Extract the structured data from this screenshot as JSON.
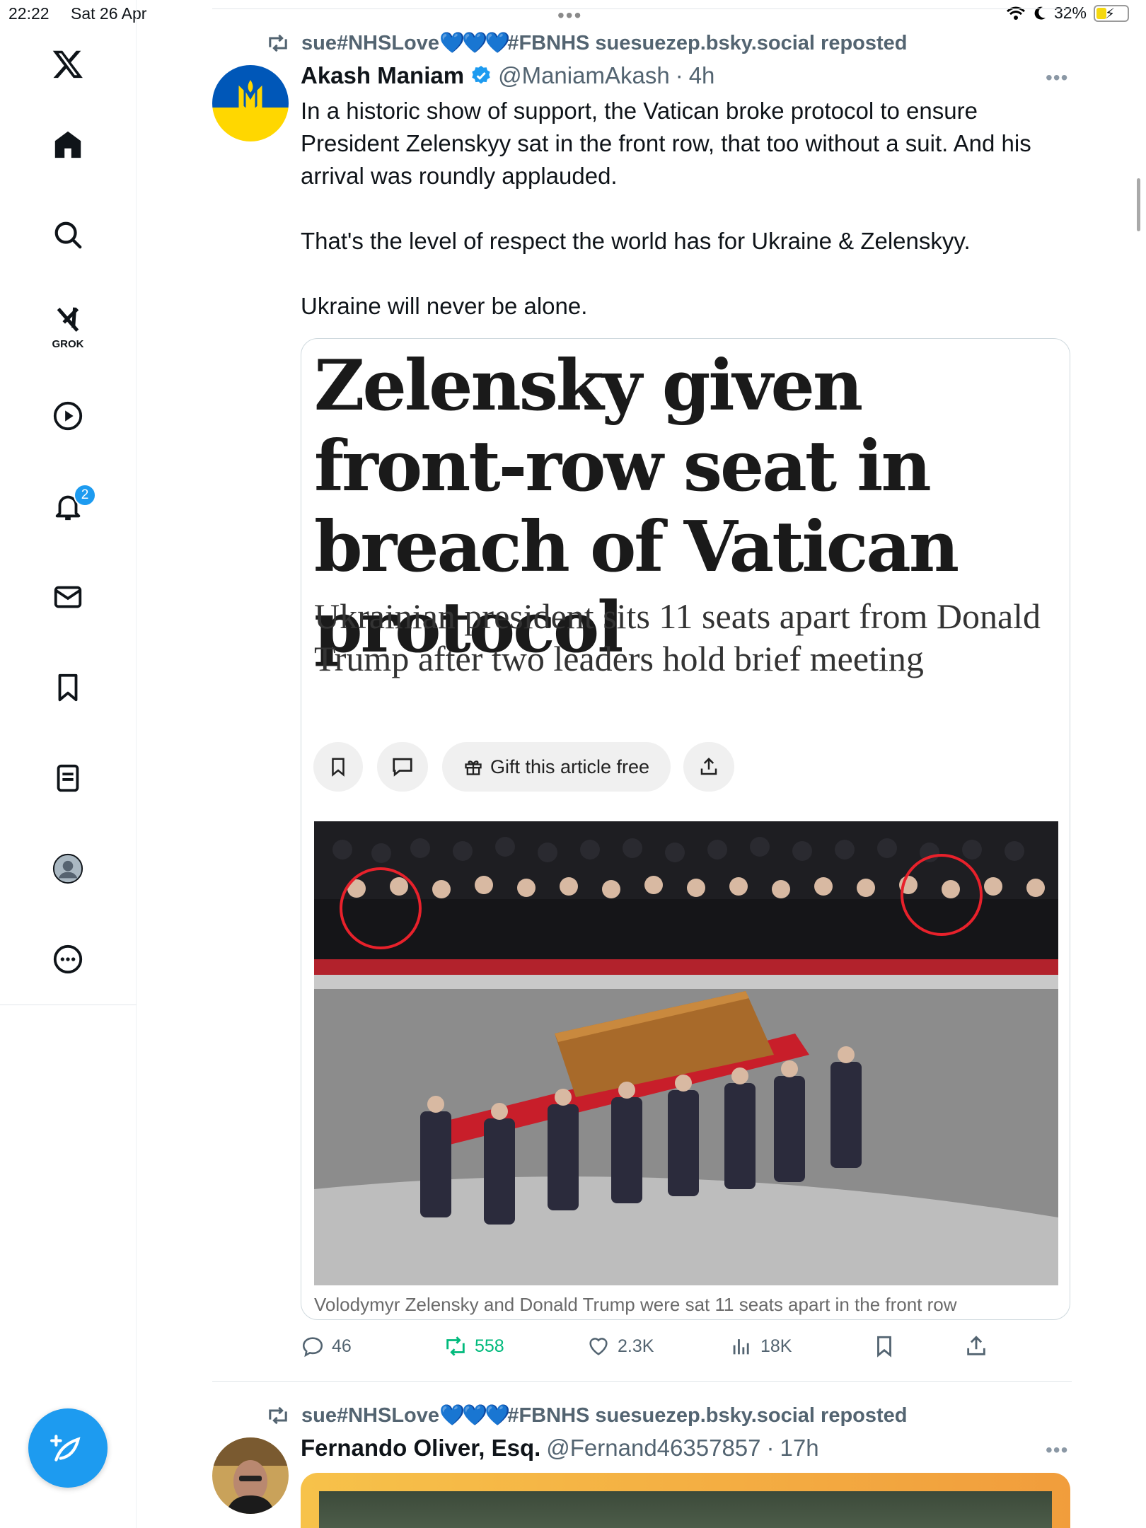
{
  "status_bar": {
    "time": "22:22",
    "date": "Sat 26 Apr",
    "battery": "32%"
  },
  "sidebar": {
    "items": [
      {
        "name": "x-logo-icon"
      },
      {
        "name": "home-icon"
      },
      {
        "name": "search-icon"
      },
      {
        "name": "grok-icon",
        "label": "GROK"
      },
      {
        "name": "video-icon"
      },
      {
        "name": "notifications-icon",
        "badge": "2"
      },
      {
        "name": "messages-icon"
      },
      {
        "name": "bookmarks-icon"
      },
      {
        "name": "lists-icon"
      },
      {
        "name": "profile-icon"
      },
      {
        "name": "more-icon"
      }
    ],
    "compose": "compose-icon"
  },
  "feed": {
    "posts": [
      {
        "repost": {
          "user": "sue#NHSLove",
          "hearts": "💙💙💙",
          "rest": "#FBNHS suesuezep.bsky.social reposted"
        },
        "author_name": "Akash Maniam",
        "verified": true,
        "handle": "@ManiamAkash",
        "time": "4h",
        "text": [
          "In a historic show of support, the Vatican broke protocol to ensure President Zelenskyy sat in the front row, that too without a suit. And his arrival was roundly applauded.",
          "That's the level of respect the world has for Ukraine & Zelenskyy.",
          "Ukraine will never be alone."
        ],
        "article": {
          "headline": "Zelensky given front-row seat in breach of Vatican protocol",
          "subhead": "Ukrainian president sits 11 seats apart from Donald Trump after two leaders hold brief meeting",
          "gift_label": "Gift this article free",
          "caption": "Volodymyr Zelensky and Donald Trump were sat 11 seats apart in the front row"
        },
        "actions": {
          "replies": "46",
          "reposts": "558",
          "likes": "2.3K",
          "views": "18K"
        }
      },
      {
        "repost": {
          "user": "sue#NHSLove",
          "hearts": "💙💙💙",
          "rest": "#FBNHS suesuezep.bsky.social reposted"
        },
        "author_name": "Fernando Oliver, Esq.",
        "handle": "@Fernand46357857",
        "time": "17h"
      }
    ]
  },
  "colors": {
    "accent": "#1d9bf0",
    "retweet": "#00ba7c",
    "muted": "#536471",
    "ukraine_blue": "#0057b8",
    "ukraine_yellow": "#ffd700"
  }
}
